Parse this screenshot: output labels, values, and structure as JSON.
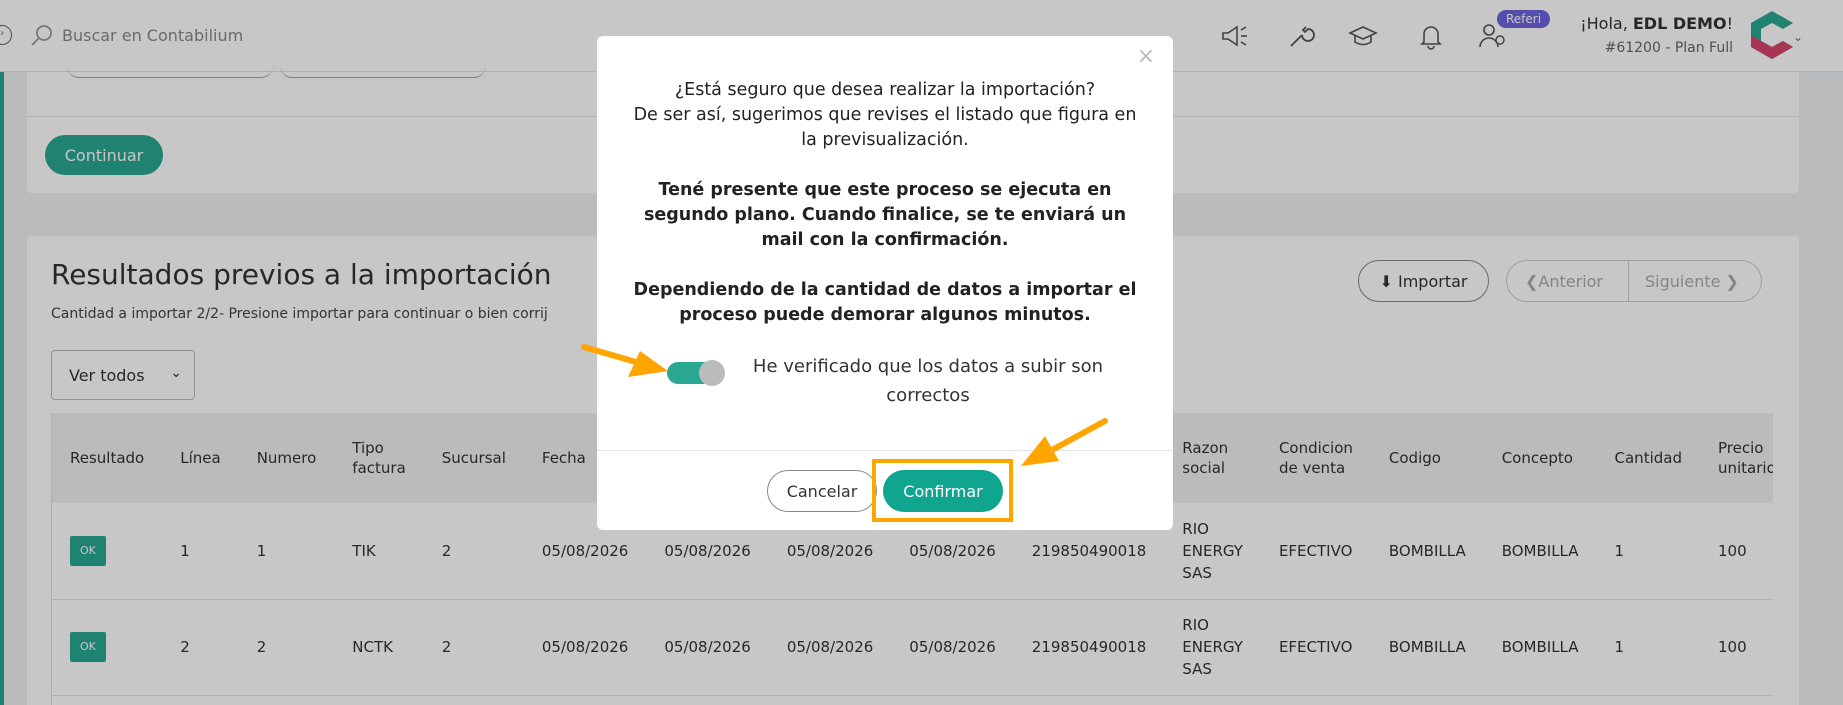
{
  "topbar": {
    "search_placeholder": "Buscar en Contabilium",
    "referi_badge": "Referi",
    "greeting_prefix": "¡Hola, ",
    "user_name": "EDL DEMO",
    "greeting_suffix": "!",
    "plan": "#61200 - Plan Full"
  },
  "top_card": {
    "continue_label": "Continuar"
  },
  "results": {
    "title": "Resultados previos a la importación",
    "subtitle": "Cantidad a importar 2/2- Presione importar para continuar o bien corrij",
    "import_label": "Importar",
    "prev_label": "Anterior",
    "next_label": "Siguiente",
    "filter_selected": "Ver todos",
    "columns": [
      "Resultado",
      "Línea",
      "Numero",
      "Tipo factura",
      "Sucursal",
      "Fecha",
      "",
      "",
      "",
      "",
      "Razon social",
      "Condicion de venta",
      "Codigo",
      "Concepto",
      "Cantidad",
      "Precio unitario"
    ],
    "rows": [
      {
        "resultado": "OK",
        "linea": "1",
        "numero": "1",
        "tipo": "TIK",
        "sucursal": "2",
        "f1": "05/08/2026",
        "f2": "05/08/2026",
        "f3": "05/08/2026",
        "f4": "05/08/2026",
        "doc": "219850490018",
        "razon": "RIO ENERGY SAS",
        "condicion": "EFECTIVO",
        "codigo": "BOMBILLA",
        "concepto": "BOMBILLA",
        "cantidad": "1",
        "precio": "100"
      },
      {
        "resultado": "OK",
        "linea": "2",
        "numero": "2",
        "tipo": "NCTK",
        "sucursal": "2",
        "f1": "05/08/2026",
        "f2": "05/08/2026",
        "f3": "05/08/2026",
        "f4": "05/08/2026",
        "doc": "219850490018",
        "razon": "RIO ENERGY SAS",
        "condicion": "EFECTIVO",
        "codigo": "BOMBILLA",
        "concepto": "BOMBILLA",
        "cantidad": "1",
        "precio": "100"
      }
    ]
  },
  "modal": {
    "close": "×",
    "question_line1": "¿Está seguro que desea realizar la importación?",
    "question_line2": "De ser así, sugerimos que revises el listado que figura en la previsualización.",
    "background_note": "Tené presente que este proceso se ejecuta en segundo plano. Cuando finalice, se te enviará un mail con la confirmación.",
    "duration_note": "Dependiendo de la cantidad de datos a importar el proceso puede demorar algunos minutos.",
    "verify_label": "He verificado que los datos a subir son correctos",
    "verify_checked": true,
    "cancel_label": "Cancelar",
    "confirm_label": "Confirmar"
  },
  "colors": {
    "brand_teal": "#2aa892",
    "confirm_teal": "#0fa58f",
    "annotation_orange": "#ffa500",
    "badge_purple": "#6c63d9"
  }
}
